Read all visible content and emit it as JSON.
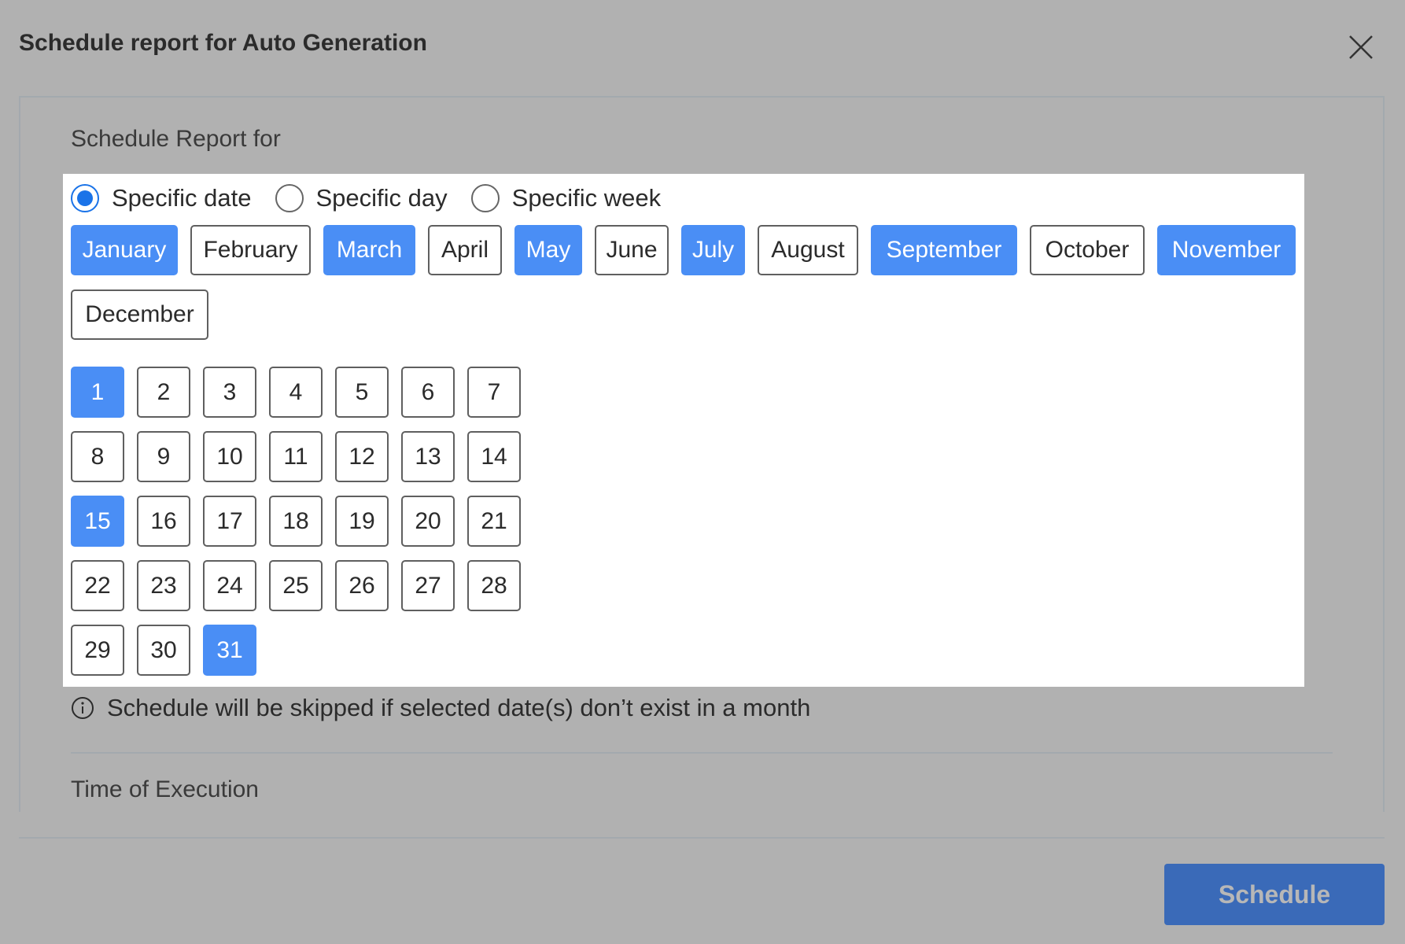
{
  "dialog": {
    "title": "Schedule report for Auto Generation"
  },
  "schedule_for": {
    "label": "Schedule Report for",
    "options": [
      {
        "label": "Specific date",
        "checked": true
      },
      {
        "label": "Specific day",
        "checked": false
      },
      {
        "label": "Specific week",
        "checked": false
      }
    ]
  },
  "months": [
    {
      "label": "January",
      "selected": true
    },
    {
      "label": "February",
      "selected": false
    },
    {
      "label": "March",
      "selected": true
    },
    {
      "label": "April",
      "selected": false
    },
    {
      "label": "May",
      "selected": true
    },
    {
      "label": "June",
      "selected": false
    },
    {
      "label": "July",
      "selected": true
    },
    {
      "label": "August",
      "selected": false
    },
    {
      "label": "September",
      "selected": true
    },
    {
      "label": "October",
      "selected": false
    },
    {
      "label": "November",
      "selected": true
    },
    {
      "label": "December",
      "selected": false
    }
  ],
  "dates": {
    "labels": [
      "1",
      "2",
      "3",
      "4",
      "5",
      "6",
      "7",
      "8",
      "9",
      "10",
      "11",
      "12",
      "13",
      "14",
      "15",
      "16",
      "17",
      "18",
      "19",
      "20",
      "21",
      "22",
      "23",
      "24",
      "25",
      "26",
      "27",
      "28",
      "29",
      "30",
      "31"
    ],
    "selected": [
      "1",
      "15",
      "31"
    ]
  },
  "info": {
    "icon": "info-icon",
    "text": "Schedule will be skipped if selected date(s) don’t exist in a month"
  },
  "time_section": {
    "label": "Time of Execution"
  },
  "footer": {
    "schedule_label": "Schedule"
  },
  "colors": {
    "selected_chip": "#4a8ef5",
    "radio_checked": "#1a73e8",
    "primary_button": "#3a6ab8",
    "backdrop": "#b1b1b1"
  }
}
